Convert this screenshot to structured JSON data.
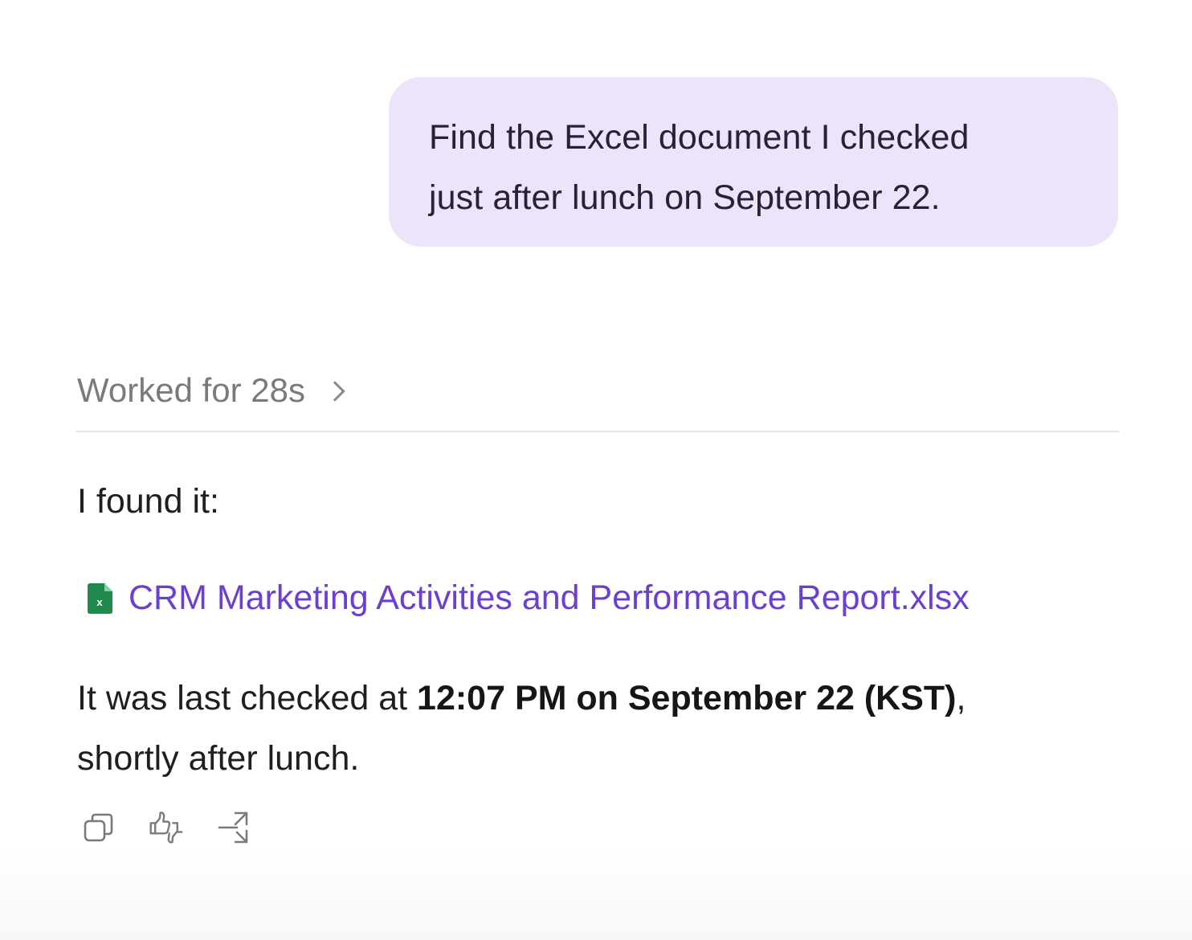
{
  "user_message": {
    "line1": "Find the Excel document I checked",
    "line2": "just after lunch on September 22."
  },
  "worked": {
    "label": "Worked for 28s"
  },
  "reply": {
    "intro": "I found it:",
    "file": {
      "icon": "excel-file-icon",
      "name": "CRM Marketing Activities and Performance Report.xlsx",
      "color": "#6b3fd1"
    },
    "answer_prefix": "It was last checked at ",
    "answer_bold": "12:07 PM on September 22 (KST)",
    "answer_suffix": ",",
    "answer_line2": "shortly after lunch."
  },
  "actions": [
    {
      "icon": "copy-icon"
    },
    {
      "icon": "thumbs-feedback-icon"
    },
    {
      "icon": "share-icon"
    }
  ],
  "colors": {
    "bubble": "#ede3fb",
    "link": "#6b3fd1",
    "muted": "#7a7a7a"
  }
}
